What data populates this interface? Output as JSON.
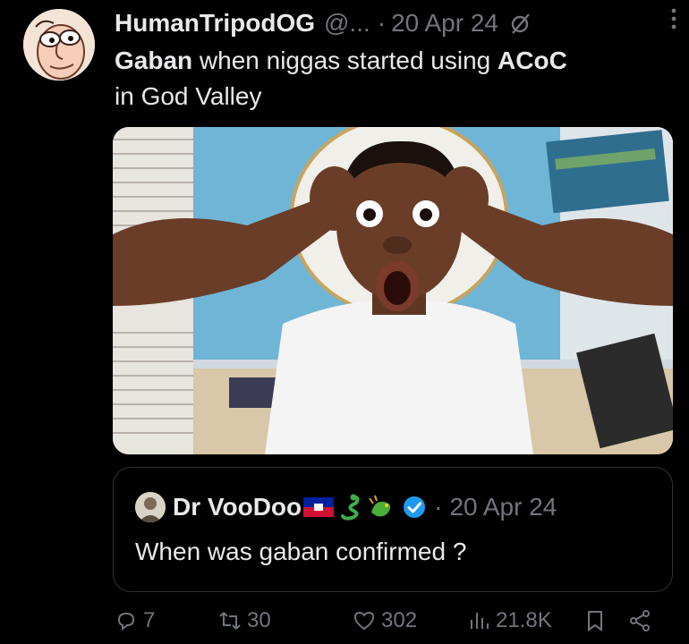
{
  "tweet": {
    "author": {
      "name": "HumanTripodOG",
      "handle": "@...",
      "separator": "·",
      "date": "20 Apr 24",
      "avatar_icon": "cartoon-face-avatar"
    },
    "text_parts": {
      "bold1": "Gaban",
      "middle": " when niggas started using ",
      "bold2": "ACoC",
      "line2": "in God Valley"
    },
    "media": {
      "type": "photo",
      "subject": "shocked-man-hands-on-head"
    },
    "quote": {
      "name": "Dr VooDoo",
      "flag_icon": "haiti-flag-icon",
      "emoji_icons": [
        "snake-icon",
        "dragon-icon"
      ],
      "verified_icon": "verified-badge-icon",
      "separator": "·",
      "date": "20 Apr 24",
      "text": "When was gaban confirmed ?"
    },
    "actions": {
      "replies": "7",
      "retweets": "30",
      "likes": "302",
      "views": "21.8K"
    },
    "colors": {
      "background": "#000000",
      "text": "#e7e9ea",
      "muted": "#71767b",
      "border": "#2f3336",
      "verified": "#1d9bf0"
    }
  }
}
